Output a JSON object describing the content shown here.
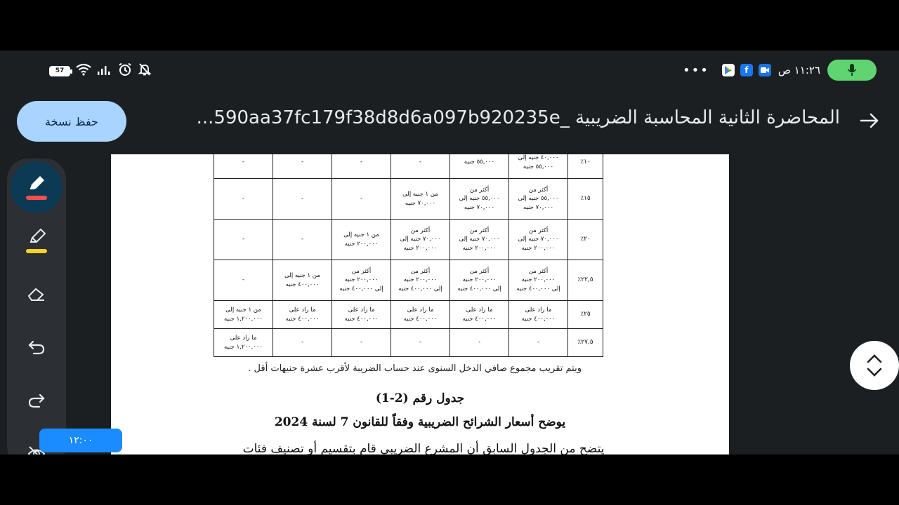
{
  "status_bar": {
    "battery": "57",
    "time": "١١:٢٦ ص",
    "more": "•••"
  },
  "app_bar": {
    "save_button": "حفظ نسخة",
    "title": "المحاضرة الثانية المحاسبة الضريبية _590aa37fc179f38d8d6a097b920235e..."
  },
  "table": {
    "rows": [
      {
        "rate": "١٠٪",
        "cells": [
          [
            "٤٠,٠٠٠ جنيه إلى",
            "٥٥,٠٠٠ جنيه"
          ],
          [
            "٥٥,٠٠٠ جنيه"
          ],
          [
            "-"
          ],
          [
            "-"
          ],
          [
            "-"
          ],
          [
            "-"
          ]
        ]
      },
      {
        "rate": "١٥٪",
        "cells": [
          [
            "أكثر من",
            "٥٥,٠٠٠ جنيه إلى",
            "٧٠,٠٠٠ جنيه"
          ],
          [
            "أكثر من",
            "٥٥,٠٠٠ جنيه إلى",
            "٧٠,٠٠٠ جنيه"
          ],
          [
            "من ١ جنيه إلى",
            "٧٠,٠٠٠ جنيه"
          ],
          [
            "-"
          ],
          [
            "-"
          ],
          [
            "-"
          ]
        ]
      },
      {
        "rate": "٢٠٪",
        "cells": [
          [
            "أكثر من",
            "٧٠,٠٠٠ جنيه إلى",
            "٢٠٠,٠٠٠ جنيه"
          ],
          [
            "أكثر من",
            "٧٠,٠٠٠ جنيه إلى",
            "٢٠٠,٠٠٠ جنيه"
          ],
          [
            "أكثر من",
            "٧٠,٠٠٠ جنيه إلى",
            "٢٠٠,٠٠٠ جنيه"
          ],
          [
            "من ١ جنيه إلى",
            "٢٠٠,٠٠٠ جنيه"
          ],
          [
            "-"
          ],
          [
            "-"
          ]
        ]
      },
      {
        "rate": "٢٢,٥٪",
        "cells": [
          [
            "أكثر من",
            "٢٠٠,٠٠٠ جنيه",
            "إلى ٤٠٠,٠٠٠ جنيه"
          ],
          [
            "أكثر من",
            "٢٠٠,٠٠٠ جنيه",
            "إلى ٤٠٠,٠٠٠ جنيه"
          ],
          [
            "أكثر من",
            "٢٠٠,٠٠٠ جنيه",
            "إلى ٤٠٠,٠٠٠ جنيه"
          ],
          [
            "أكثر من",
            "٢٠٠,٠٠٠ جنيه",
            "إلى ٤٠٠,٠٠٠ جنيه"
          ],
          [
            "من ١ جنيه إلى",
            "٤٠٠,٠٠٠ جنيه"
          ],
          [
            "-"
          ]
        ]
      },
      {
        "rate": "٢٥٪",
        "cells": [
          [
            "ما زاد على",
            "٤٠٠,٠٠٠ جنيه"
          ],
          [
            "ما زاد على",
            "٤٠٠,٠٠٠ جنيه"
          ],
          [
            "ما زاد على",
            "٤٠٠,٠٠٠ جنيه"
          ],
          [
            "ما زاد على",
            "٤٠٠,٠٠٠ جنيه"
          ],
          [
            "ما زاد على",
            "٤٠٠,٠٠٠ جنيه"
          ],
          [
            "من ١ جنيه إلى",
            "١,٢٠٠,٠٠٠ جنيه"
          ]
        ]
      },
      {
        "rate": "٢٧,٥٪",
        "cells": [
          [
            "-"
          ],
          [
            "-"
          ],
          [
            "-"
          ],
          [
            "-"
          ],
          [
            "-"
          ],
          [
            "ما زاد على",
            "١,٢٠٠,٠٠٠ جنيه"
          ]
        ]
      }
    ]
  },
  "document": {
    "note": "ويتم تقريب مجموع صافي الدخل السنوى عند حساب الضريبة لأقرب عشرة جنيهات أقل .",
    "caption_number": "جدول رقم (2-1)",
    "caption_title": "يوضح أسعار الشرائح الضريبية وفقاً للقانون 7 لسنة 2024",
    "body_partial": "يتضح من الجدول السابق أن المشرع الضريبي قام بتقسيم أو تصنيف فئات"
  },
  "timer": "١٢:٠٠",
  "colors": {
    "accent_blue": "#a8d4ff",
    "mic_green": "#5fd470",
    "pen_red": "#ff4d4d",
    "highlighter_yellow": "#ffd21f",
    "timer_blue": "#1a8cff"
  }
}
